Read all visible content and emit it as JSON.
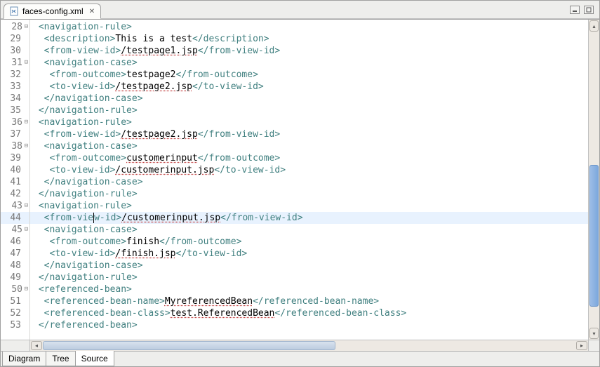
{
  "editor": {
    "tab_title": "faces-config.xml",
    "close_label": "✕"
  },
  "gutter": {
    "start": 28,
    "end": 53,
    "fold_lines": [
      28,
      31,
      36,
      38,
      43,
      45,
      50
    ],
    "highlight": 44
  },
  "code": [
    {
      "n": 28,
      "indent": 1,
      "open": "navigation-rule",
      "close_same": false
    },
    {
      "n": 29,
      "indent": 2,
      "open": "description",
      "text": "This is a test",
      "close": "description"
    },
    {
      "n": 30,
      "indent": 2,
      "open": "from-view-id",
      "text": "/testpage1.jsp",
      "close": "from-view-id",
      "decor": "under"
    },
    {
      "n": 31,
      "indent": 2,
      "open": "navigation-case",
      "close_same": false
    },
    {
      "n": 32,
      "indent": 3,
      "open": "from-outcome",
      "text": "testpage2",
      "close": "from-outcome"
    },
    {
      "n": 33,
      "indent": 3,
      "open": "to-view-id",
      "text": "/testpage2.jsp",
      "close": "to-view-id",
      "decor": "under"
    },
    {
      "n": 34,
      "indent": 2,
      "closetag": "navigation-case"
    },
    {
      "n": 35,
      "indent": 1,
      "closetag": "navigation-rule"
    },
    {
      "n": 36,
      "indent": 1,
      "open": "navigation-rule",
      "close_same": false
    },
    {
      "n": 37,
      "indent": 2,
      "open": "from-view-id",
      "text": "/testpage2.jsp",
      "close": "from-view-id",
      "decor": "under"
    },
    {
      "n": 38,
      "indent": 2,
      "open": "navigation-case",
      "close_same": false
    },
    {
      "n": 39,
      "indent": 3,
      "open": "from-outcome",
      "text": "customerinput",
      "close": "from-outcome",
      "decor": "under"
    },
    {
      "n": 40,
      "indent": 3,
      "open": "to-view-id",
      "text": "/customerinput.jsp",
      "close": "to-view-id",
      "decor": "under"
    },
    {
      "n": 41,
      "indent": 2,
      "closetag": "navigation-case"
    },
    {
      "n": 42,
      "indent": 1,
      "closetag": "navigation-rule"
    },
    {
      "n": 43,
      "indent": 1,
      "open": "navigation-rule",
      "close_same": false
    },
    {
      "n": 44,
      "indent": 2,
      "raw": {
        "pre": "<from-vie",
        "caret": true,
        "post": "w-id>",
        "text": "/customerinput.jsp",
        "close": "from-view-id",
        "decor": "under"
      }
    },
    {
      "n": 45,
      "indent": 2,
      "open": "navigation-case",
      "close_same": false
    },
    {
      "n": 46,
      "indent": 3,
      "open": "from-outcome",
      "text": "finish",
      "close": "from-outcome"
    },
    {
      "n": 47,
      "indent": 3,
      "open": "to-view-id",
      "text": "/finish.jsp",
      "close": "to-view-id",
      "decor": "under"
    },
    {
      "n": 48,
      "indent": 2,
      "closetag": "navigation-case"
    },
    {
      "n": 49,
      "indent": 1,
      "closetag": "navigation-rule"
    },
    {
      "n": 50,
      "indent": 1,
      "open": "referenced-bean",
      "close_same": false
    },
    {
      "n": 51,
      "indent": 2,
      "open": "referenced-bean-name",
      "text": "MyreferencedBean",
      "close": "referenced-bean-name",
      "decor": "under"
    },
    {
      "n": 52,
      "indent": 2,
      "open": "referenced-bean-class",
      "text": "test.ReferencedBean",
      "close": "referenced-bean-class",
      "decor": "under"
    },
    {
      "n": 53,
      "indent": 1,
      "closetag": "referenced-bean"
    }
  ],
  "bottom_tabs": {
    "items": [
      "Diagram",
      "Tree",
      "Source"
    ],
    "active": "Source"
  },
  "scroll": {
    "v_thumb_top_pct": 45,
    "v_thumb_height_pct": 48,
    "h_thumb_left_pct": 0,
    "h_thumb_width_pct": 55
  },
  "arrows": {
    "up": "▴",
    "down": "▾",
    "left": "◂",
    "right": "▸"
  }
}
